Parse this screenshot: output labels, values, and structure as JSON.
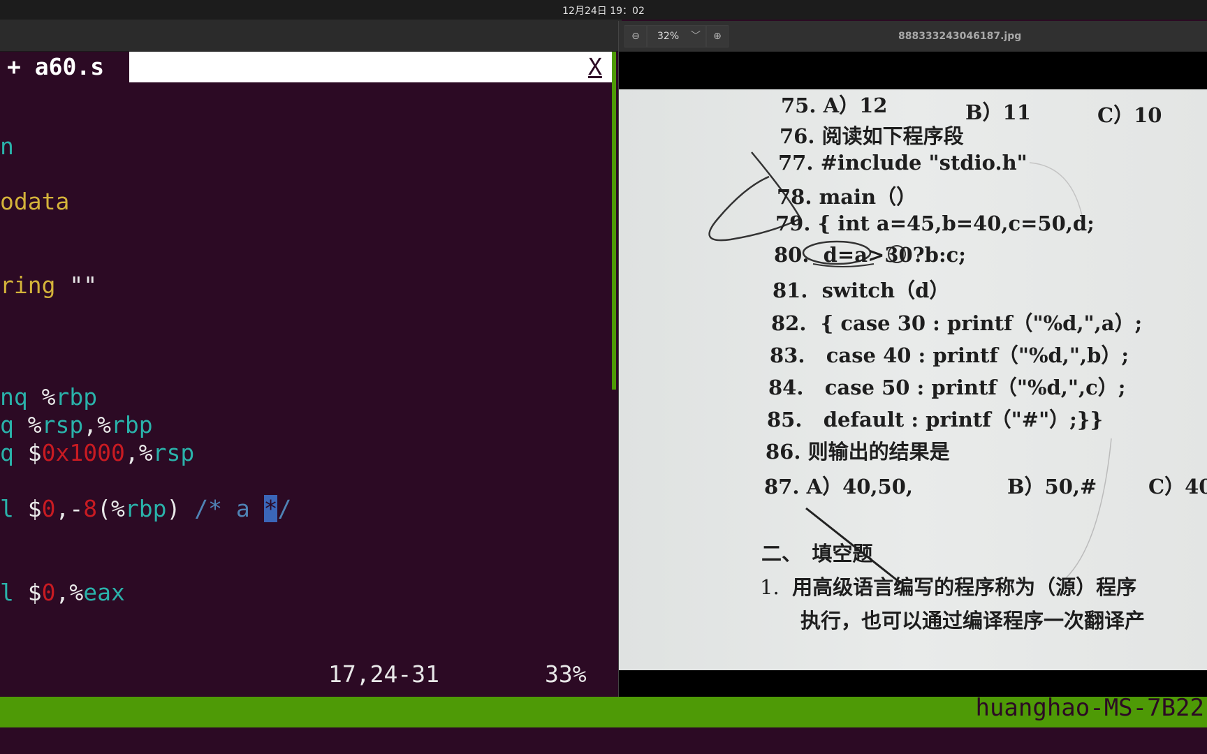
{
  "topbar": {
    "clock": "12月24日 19：02"
  },
  "terminal": {
    "tab_name": "+ a60.s",
    "tab_close": "X",
    "ruler": "17,24-31",
    "percent": "33%"
  },
  "statusbar": {
    "hostname": "huanghao-MS-7B22"
  },
  "viewer": {
    "zoom": "32%",
    "filename": "888333243046187.jpg"
  },
  "photo": {
    "lines": [
      {
        "num": "75.",
        "text": "A）12",
        "b": "B）11",
        "c": "C）10"
      },
      {
        "num": "76.",
        "text": "阅读如下程序段"
      },
      {
        "num": "77.",
        "text": "#include \"stdio.h\""
      },
      {
        "num": "78.",
        "text": "main（）"
      },
      {
        "num": "79.",
        "text": "{ int a=45,b=40,c=50,d;"
      },
      {
        "num": "80.",
        "text": "d=a>30?b:c;"
      },
      {
        "num": "81.",
        "text": "switch（d）"
      },
      {
        "num": "82.",
        "text": "{ case 30 : printf（\"%d,\",a）;"
      },
      {
        "num": "83.",
        "text": "case 40 : printf（\"%d,\",b）;"
      },
      {
        "num": "84.",
        "text": "case 50 : printf（\"%d,\",c）;"
      },
      {
        "num": "85.",
        "text": "default : printf（\"#\"）;}}"
      },
      {
        "num": "86.",
        "text": "则输出的结果是"
      },
      {
        "num": "87.",
        "text": "A）40,50,",
        "b": "B）50,#",
        "c": "C）40"
      }
    ],
    "section": "二、　填空题",
    "item1_num": "1.",
    "item1_text": "用高级语言编写的程序称为（源）程序",
    "item2_text": "执行，也可以通过编译程序一次翻译产"
  }
}
